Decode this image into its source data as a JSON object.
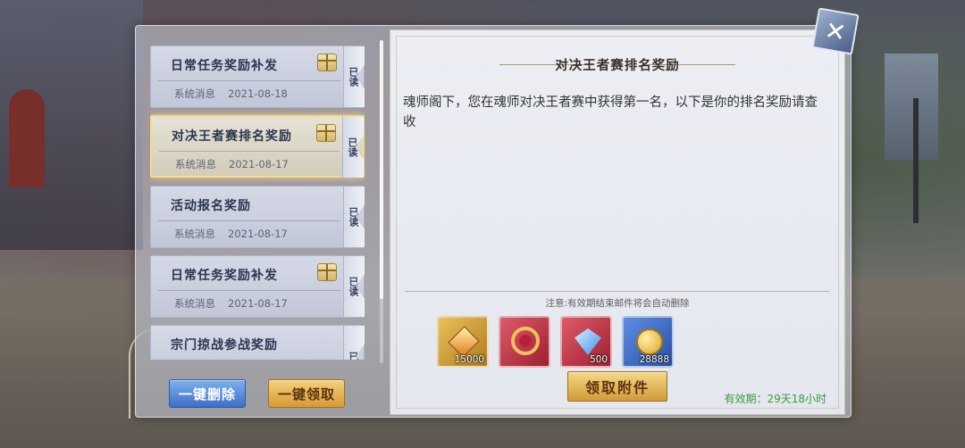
{
  "mail_list": [
    {
      "title": "日常任务奖励补发",
      "sender": "系统消息",
      "date": "2021-08-18",
      "read_label": "已读",
      "has_gift": true,
      "selected": false
    },
    {
      "title": "对决王者赛排名奖励",
      "sender": "系统消息",
      "date": "2021-08-17",
      "read_label": "已读",
      "has_gift": true,
      "selected": true
    },
    {
      "title": "活动报名奖励",
      "sender": "系统消息",
      "date": "2021-08-17",
      "read_label": "已读",
      "has_gift": false,
      "selected": false
    },
    {
      "title": "日常任务奖励补发",
      "sender": "系统消息",
      "date": "2021-08-17",
      "read_label": "已读",
      "has_gift": true,
      "selected": false
    },
    {
      "title": "宗门掠战参战奖励",
      "sender": "",
      "date": "",
      "read_label": "已",
      "has_gift": false,
      "selected": false
    }
  ],
  "buttons": {
    "delete_all": "一键删除",
    "claim_all": "一键领取",
    "claim_attachment": "领取附件"
  },
  "letter": {
    "title": "对决王者赛排名奖励",
    "body": "魂师阁下，您在魂师对决王者赛中获得第一名，以下是你的排名奖励请查收",
    "note": "注意:有效期结束邮件将会自动删除",
    "validity": "有效期：29天18小时"
  },
  "attachments": [
    {
      "icon": "gold-gem-token-icon",
      "count": "15000"
    },
    {
      "icon": "ruby-ring-icon",
      "count": ""
    },
    {
      "icon": "blue-diamond-icon",
      "count": "500"
    },
    {
      "icon": "gold-coins-icon",
      "count": "28888"
    }
  ],
  "close_label": "✕",
  "colors": {
    "selected_border": "#f3dc8c",
    "validity_text": "#3b9a3b",
    "delete_button": "#3d6fc6",
    "claim_button": "#d79a34"
  }
}
